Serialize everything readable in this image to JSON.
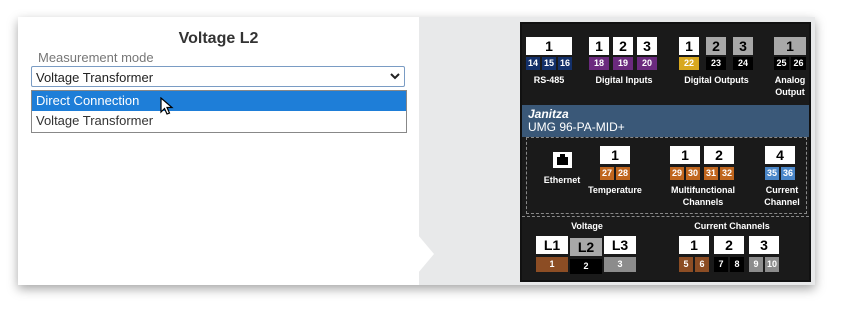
{
  "config": {
    "title": "Voltage L2",
    "measurement_label": "Measurement mode",
    "selected_value": "Voltage Transformer",
    "options": [
      "Direct Connection",
      "Voltage Transformer"
    ],
    "highlighted_option": "Direct Connection"
  },
  "device": {
    "brand": "Janitza",
    "model": "UMG 96-PA-MID+",
    "top": {
      "rs485": {
        "label": "RS-485",
        "box": "1",
        "pins": [
          "14",
          "15",
          "16"
        ]
      },
      "digital_inputs": {
        "label": "Digital Inputs",
        "boxes": [
          "1",
          "2",
          "3"
        ],
        "pins": [
          "18",
          "19",
          "20"
        ]
      },
      "digital_outputs": {
        "label": "Digital Outputs",
        "boxes": [
          "1",
          "2",
          "3"
        ],
        "pins": [
          "22",
          "23",
          "24"
        ]
      },
      "analog_output": {
        "label1": "Analog",
        "label2": "Output",
        "box": "1",
        "pins": [
          "25",
          "26"
        ]
      }
    },
    "mid": {
      "ethernet": {
        "label": "Ethernet"
      },
      "temperature": {
        "label": "Temperature",
        "box": "1",
        "pins": [
          "27",
          "28"
        ]
      },
      "multi": {
        "label1": "Multifunctional",
        "label2": "Channels",
        "boxes": [
          "1",
          "2"
        ],
        "pins": [
          "29",
          "30",
          "31",
          "32"
        ]
      },
      "current_channel": {
        "label1": "Current",
        "label2": "Channel",
        "box": "4",
        "pins": [
          "35",
          "36"
        ]
      }
    },
    "bottom": {
      "voltage": {
        "label": "Voltage",
        "boxes": [
          "L1",
          "L2",
          "L3"
        ],
        "pins": [
          "1",
          "2",
          "3"
        ]
      },
      "current": {
        "label": "Current Channels",
        "boxes": [
          "1",
          "2",
          "3"
        ],
        "pins": [
          "5",
          "6",
          "7",
          "8",
          "9",
          "10"
        ]
      }
    }
  }
}
